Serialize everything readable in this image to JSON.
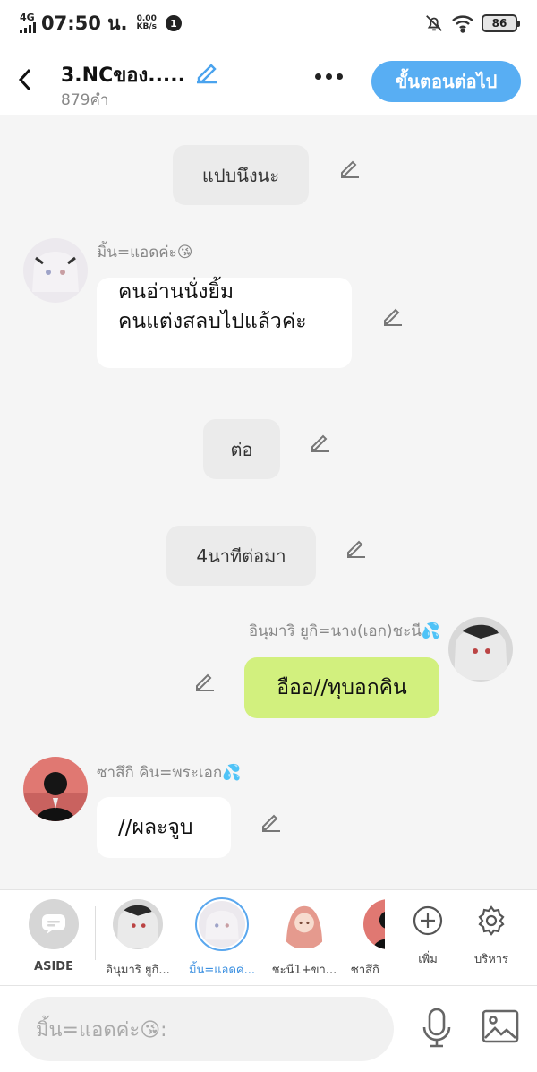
{
  "status_bar": {
    "network": "4G",
    "time": "07:50 น.",
    "speed_value": "0.00",
    "speed_unit": "KB/s",
    "notification_count": "1",
    "battery": "86"
  },
  "header": {
    "title": "3.NCของ.....",
    "word_count": "879คำ",
    "next_button": "ขั้นตอนต่อไป"
  },
  "messages": [
    {
      "type": "narration",
      "text": "แปบนึงนะ"
    },
    {
      "type": "left",
      "speaker": "มิ้น=แอดค่ะ😘",
      "lines": [
        "คนอ่านนั่งยิ้ม",
        "คนแต่งสลบไปแล้วค่ะ"
      ]
    },
    {
      "type": "narration",
      "text": "ต่อ"
    },
    {
      "type": "narration",
      "text": "4นาทีต่อมา"
    },
    {
      "type": "right",
      "speaker": "อินุมาริ ยูกิ=นาง(เอก)ชะนี💦",
      "text": "อืออ//ทุบอกคิน"
    },
    {
      "type": "left",
      "speaker": "ซาสึกิ คิน=พระเอก💦",
      "text": "//ผละจูบ"
    }
  ],
  "character_bar": {
    "aside_label": "ASIDE",
    "characters": [
      {
        "label": "อินุมาริ ยูกิ..."
      },
      {
        "label": "มิ้น=แอดค่...",
        "selected": true
      },
      {
        "label": "ชะนี1+ขา..."
      },
      {
        "label": "ซาสึกิ"
      }
    ],
    "add_label": "เพิ่ม",
    "manage_label": "บริหาร"
  },
  "input": {
    "placeholder": "มิ้น=แอดค่ะ😘:"
  },
  "colors": {
    "accent": "#58aef3",
    "green_bubble": "#d2f07e",
    "narration_bubble": "#ebebeb",
    "background": "#f5f5f5"
  }
}
